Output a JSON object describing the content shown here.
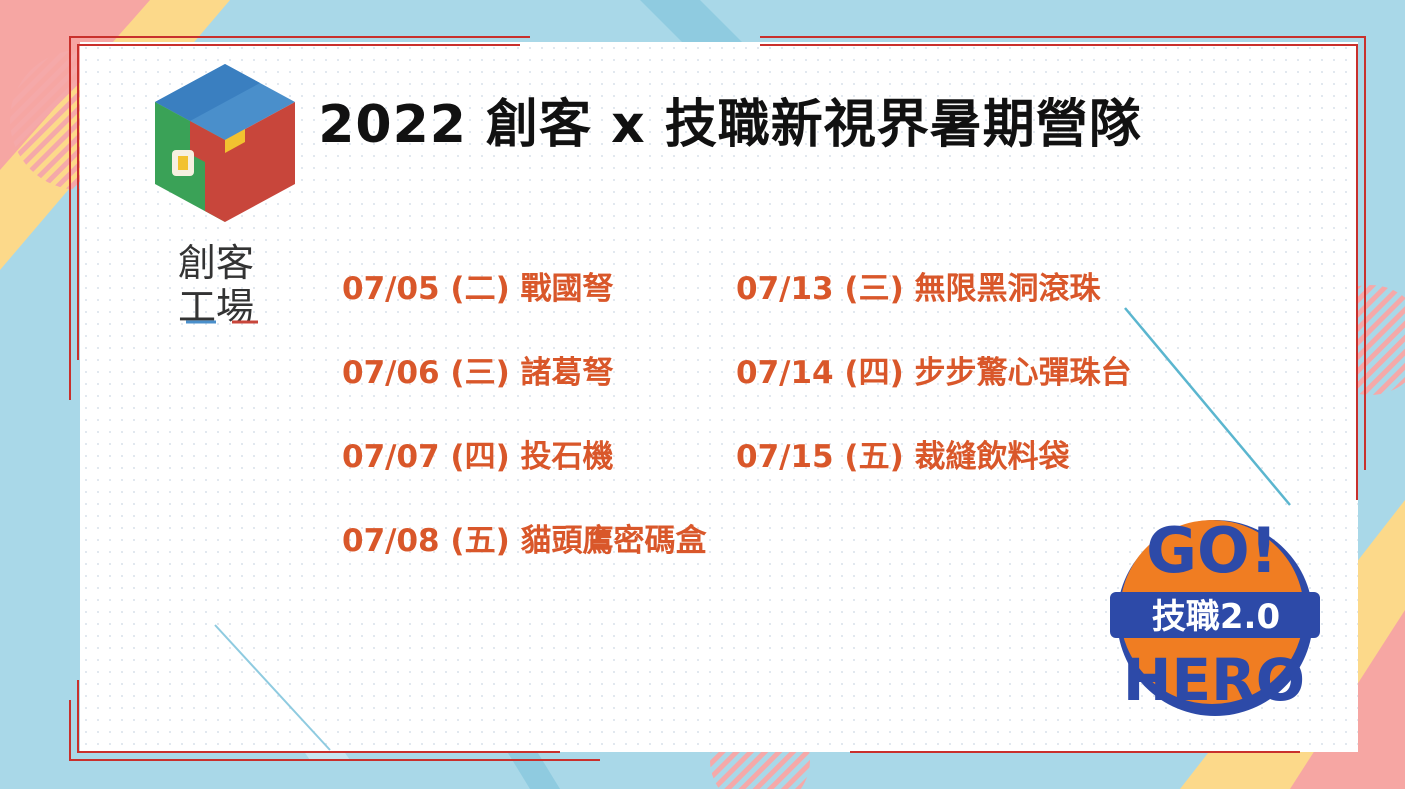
{
  "title": "2022 創客 x 技職新視界暑期營隊",
  "left_schedule": [
    {
      "date": "07/05",
      "weekday": "(二)",
      "name": "戰國弩"
    },
    {
      "date": "07/06",
      "weekday": "(三)",
      "name": "諸葛弩"
    },
    {
      "date": "07/07",
      "weekday": "(四)",
      "name": "投石機"
    },
    {
      "date": "07/08",
      "weekday": "(五)",
      "name": "貓頭鷹密碼盒"
    }
  ],
  "right_schedule": [
    {
      "date": "07/13",
      "weekday": "(三)",
      "name": "無限黑洞滾珠"
    },
    {
      "date": "07/14",
      "weekday": "(四)",
      "name": "步步驚心彈珠台"
    },
    {
      "date": "07/15",
      "weekday": "(五)",
      "name": "裁縫飲料袋"
    }
  ],
  "logo": {
    "line1": "創客",
    "line2": "工場"
  },
  "badge": {
    "top": "GO!",
    "middle": "技職2.0",
    "bottom": "HERO"
  },
  "colors": {
    "accent": "#d9572a",
    "frame": "#c9302c",
    "background": "#a9d8e8",
    "badge_orange": "#f07d22",
    "badge_blue": "#2d4aa8"
  }
}
